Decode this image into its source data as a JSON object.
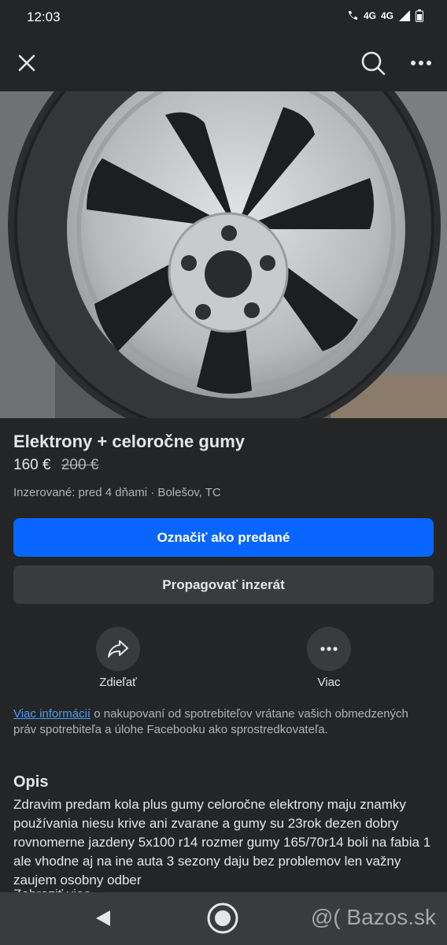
{
  "status": {
    "time": "12:03",
    "network_1": "4G",
    "network_2": "4G"
  },
  "toolbar": {
    "close_icon": "close-icon",
    "search_icon": "search-icon",
    "more_icon": "more-horizontal-icon"
  },
  "carousel": {
    "total": 8,
    "active_index": 0
  },
  "listing": {
    "title": "Elektrony + celoročne gumy",
    "price": "160 €",
    "old_price": "200 €",
    "meta": "Inzerované: pred 4 dňami · Bolešov, TC"
  },
  "buttons": {
    "mark_sold": "Označiť ako predané",
    "promote": "Propagovať inzerát"
  },
  "actions": {
    "share": "Zdieľať",
    "more": "Viac"
  },
  "consumer": {
    "link": "Viac informácií",
    "text": " o nakupovaní od spotrebiteľov vrátane vašich obmedzených práv spotrebiteľa a úlohe Facebooku ako sprostredkovateľa."
  },
  "description": {
    "heading": "Opis",
    "body": "Zdravim predam kola plus gumy celoročne elektrony maju znamky používania  niesu krive ani zvarane a gumy su 23rok dezen dobry rovnomerne jazdeny  5x100 r14 rozmer gumy 165/70r14 boli na fabia 1 ale vhodne aj na ine auta 3 sezony daju bez problemov len važny zaujem osobny odber",
    "peek": "Zobraziť viac"
  },
  "watermark": "@( Bazos.sk",
  "colors": {
    "background": "#242526",
    "primary": "#0866ff",
    "secondary": "#3a3b3c",
    "link": "#4b9cf5"
  }
}
